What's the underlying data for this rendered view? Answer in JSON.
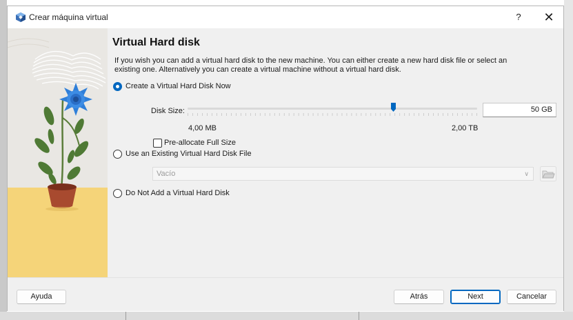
{
  "window": {
    "title": "Crear máquina virtual",
    "help_label": "?",
    "close_label": "✕"
  },
  "page": {
    "heading": "Virtual Hard disk",
    "description": "If you wish you can add a virtual hard disk to the new machine. You can either create a new hard disk file or select an existing one. Alternatively you can create a virtual machine without a virtual hard disk."
  },
  "options": {
    "create_now": {
      "label": "Create a Virtual Hard Disk Now",
      "selected": true
    },
    "use_existing": {
      "label": "Use an Existing Virtual Hard Disk File",
      "selected": false
    },
    "no_disk": {
      "label": "Do Not Add a Virtual Hard Disk",
      "selected": false
    }
  },
  "disk": {
    "size_label": "Disk Size:",
    "size_value": "50 GB",
    "min_label": "4,00 MB",
    "max_label": "2,00 TB",
    "slider_fraction": 0.71,
    "preallocate_label": "Pre-allocate Full Size",
    "preallocate_checked": false
  },
  "existing_file": {
    "combo_value": "Vacío",
    "chevron": "chevron-down-icon",
    "browse_icon": "folder-icon"
  },
  "buttons": {
    "help": "Ayuda",
    "back": "Atrás",
    "next": "Next",
    "cancel": "Cancelar"
  },
  "colors": {
    "accent": "#0067c0",
    "illustration_yellow": "#f5d479",
    "flower_blue": "#2f7fd9"
  }
}
